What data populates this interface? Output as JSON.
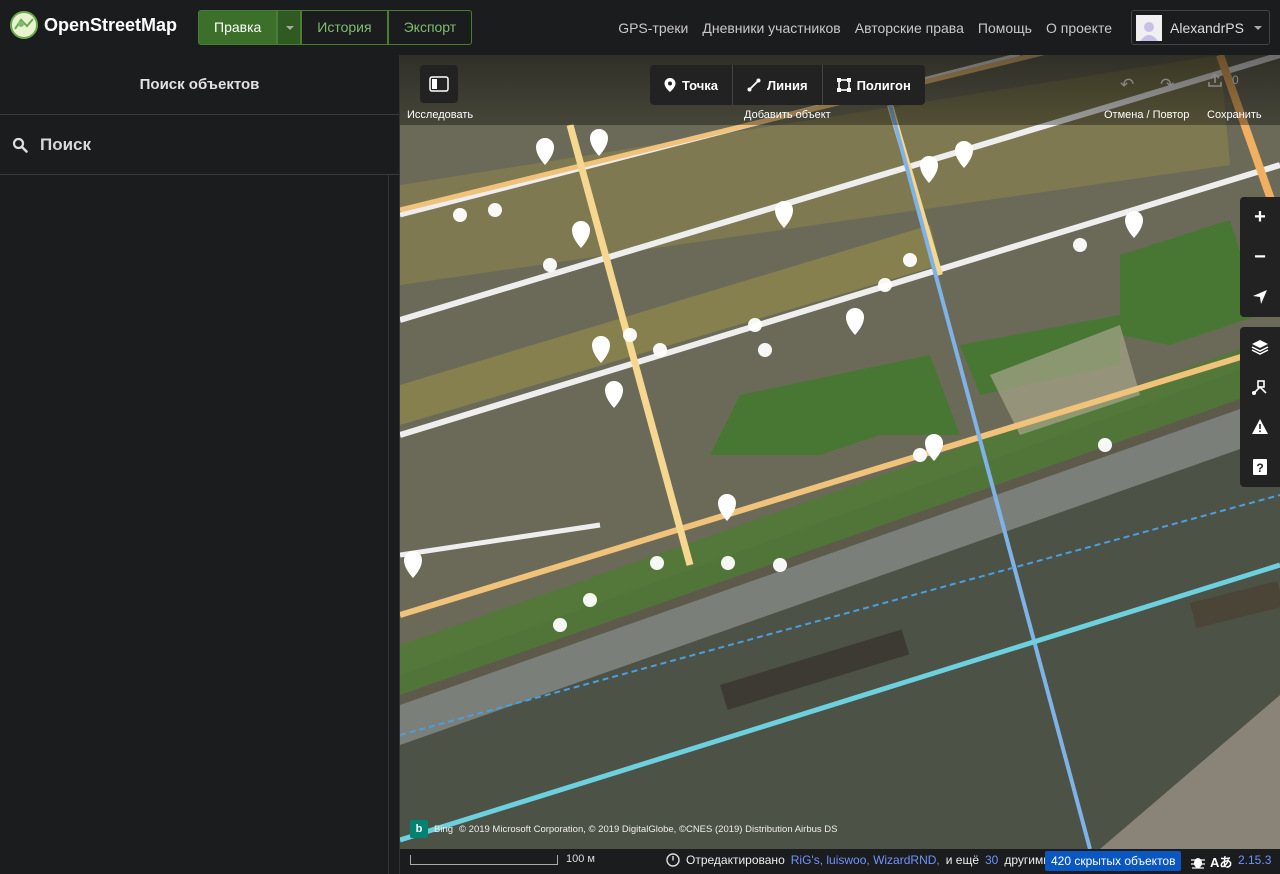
{
  "header": {
    "logo_text": "OpenStreetMap",
    "modes": [
      {
        "label": "Правка",
        "active": true
      },
      {
        "label": "История",
        "active": false
      },
      {
        "label": "Экспорт",
        "active": false
      }
    ],
    "links": [
      "GPS-треки",
      "Дневники участников",
      "Авторские права",
      "Помощь",
      "О проекте"
    ],
    "user_name": "AlexandrPS"
  },
  "sidebar": {
    "title": "Поиск объектов",
    "search_placeholder": "Поиск"
  },
  "map": {
    "toolbar": {
      "explore_label": "Исследовать",
      "add_buttons": [
        {
          "label": "Точка",
          "icon": "point-icon"
        },
        {
          "label": "Линия",
          "icon": "line-icon"
        },
        {
          "label": "Полигон",
          "icon": "polygon-icon"
        }
      ],
      "add_label": "Добавить объект",
      "undo_redo_label": "Отмена / Повтор",
      "save_label": "Сохранить",
      "save_count": "0"
    },
    "map_controls": [
      "zoom-in-icon",
      "zoom-out-icon",
      "geolocate-icon"
    ],
    "panel_controls": [
      "layers-icon",
      "map-data-icon",
      "issues-icon",
      "help-icon"
    ],
    "attribution": {
      "provider": "Bing",
      "text": "© 2019 Microsoft Corporation, © 2019 DigitalGlobe, ©CNES (2019) Distribution Airbus DS"
    }
  },
  "footer": {
    "scale_label": "100 м",
    "edited_prefix": "Отредактировано",
    "editors": "RiG's, luiswoo, WizardRND,",
    "and_more": "и ещё",
    "count": "30",
    "others": "другими",
    "hidden_objects": "420 скрытых объектов",
    "version": "2.15.3"
  },
  "colors": {
    "accent_green": "#7ebc6f",
    "active_green": "#3b6f2a",
    "link_blue": "#7092ff",
    "badge_blue": "#0a57c2"
  }
}
